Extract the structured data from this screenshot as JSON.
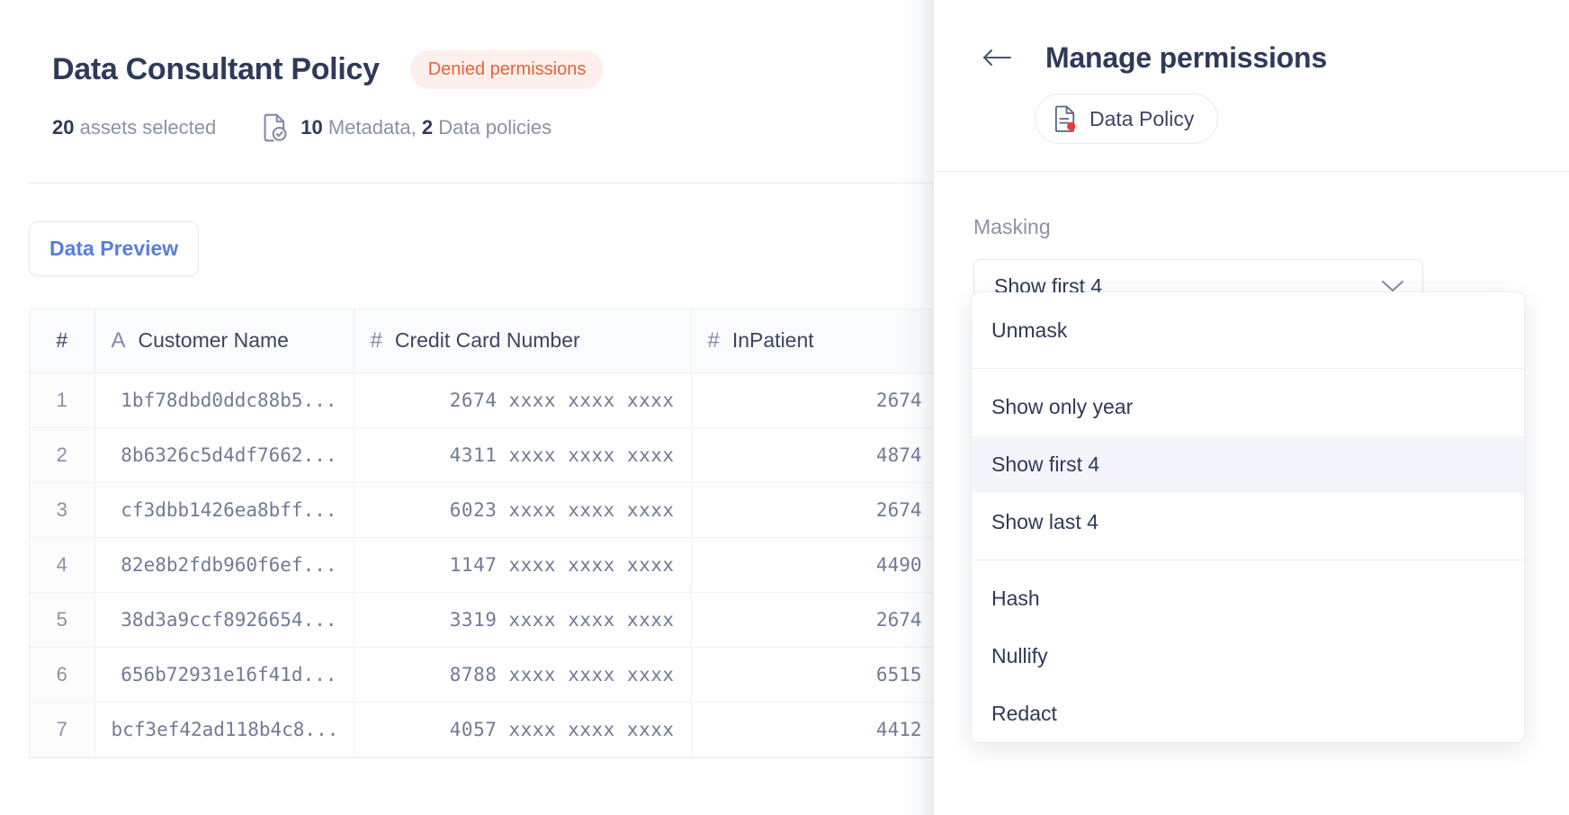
{
  "page": {
    "title": "Data Consultant Policy",
    "status_badge": "Denied permissions",
    "assets_count": "20",
    "assets_label": "assets selected",
    "metadata_count": "10",
    "metadata_label": "Metadata,",
    "policies_count": "2",
    "policies_label": "Data policies",
    "tab_label": "Data Preview"
  },
  "table": {
    "columns": [
      {
        "label": "#",
        "type_icon": ""
      },
      {
        "label": "Customer Name",
        "type_icon": "A"
      },
      {
        "label": "Credit Card Number",
        "type_icon": "#"
      },
      {
        "label": "InPatient",
        "type_icon": "#"
      }
    ],
    "rows": [
      {
        "idx": "1",
        "name": "1bf78dbd0ddc88b5...",
        "cc": "2674 xxxx xxxx xxxx",
        "ip": "2674"
      },
      {
        "idx": "2",
        "name": "8b6326c5d4df7662...",
        "cc": "4311 xxxx xxxx xxxx",
        "ip": "4874"
      },
      {
        "idx": "3",
        "name": "cf3dbb1426ea8bff...",
        "cc": "6023 xxxx xxxx xxxx",
        "ip": "2674"
      },
      {
        "idx": "4",
        "name": "82e8b2fdb960f6ef...",
        "cc": "1147 xxxx xxxx xxxx",
        "ip": "4490"
      },
      {
        "idx": "5",
        "name": "38d3a9ccf8926654...",
        "cc": "3319 xxxx xxxx xxxx",
        "ip": "2674"
      },
      {
        "idx": "6",
        "name": "656b72931e16f41d...",
        "cc": "8788 xxxx xxxx xxxx",
        "ip": "6515"
      },
      {
        "idx": "7",
        "name": "bcf3ef42ad118b4c8...",
        "cc": "4057 xxxx xxxx xxxx",
        "ip": "4412"
      }
    ]
  },
  "panel": {
    "title": "Manage permissions",
    "policy_chip": "Data Policy",
    "masking_label": "Masking",
    "masking_value": "Show first 4",
    "options": [
      {
        "label": "Unmask",
        "selected": false,
        "separator_after": true
      },
      {
        "label": "Show only year",
        "selected": false,
        "separator_after": false
      },
      {
        "label": "Show first 4",
        "selected": true,
        "separator_after": false
      },
      {
        "label": "Show last 4",
        "selected": false,
        "separator_after": true
      },
      {
        "label": "Hash",
        "selected": false,
        "separator_after": false
      },
      {
        "label": "Nullify",
        "selected": false,
        "separator_after": false
      },
      {
        "label": "Redact",
        "selected": false,
        "separator_after": false
      }
    ]
  },
  "colors": {
    "accent_blue": "#5b7ce0",
    "danger_orange": "#e8603c",
    "badge_bg": "#fdf0ec",
    "text_dark": "#2e3a59",
    "text_muted": "#8b91a8",
    "selected_bg": "#f4f5fb"
  }
}
